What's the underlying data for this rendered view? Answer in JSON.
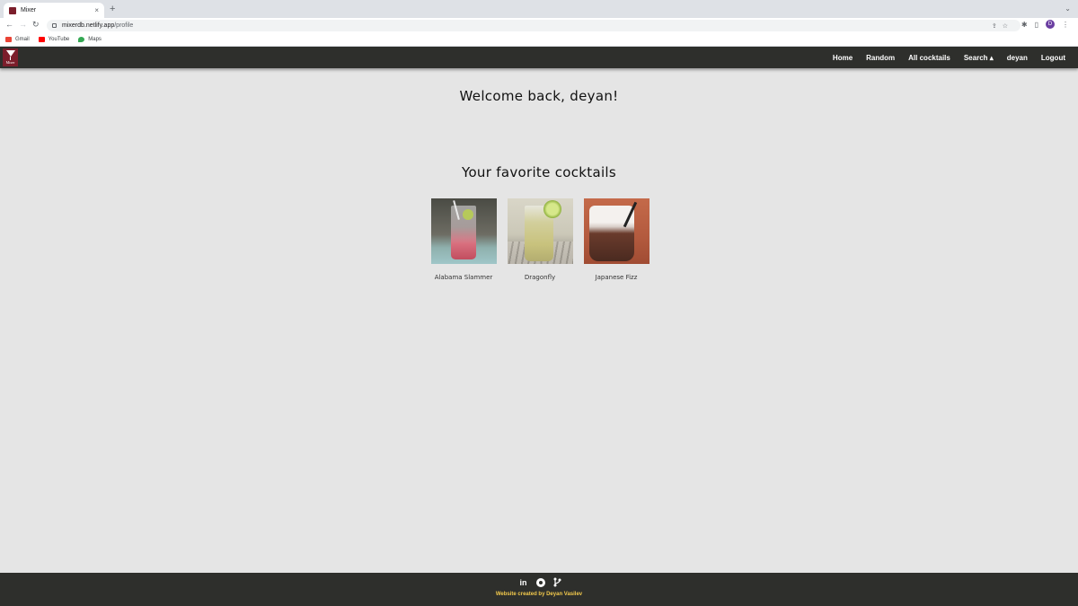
{
  "browser": {
    "tab_title": "Mixer",
    "tab_close": "×",
    "new_tab": "+",
    "url_host": "mixerdb.netlify.app",
    "url_path": "/profile",
    "profile_initial": "D",
    "bookmarks": [
      {
        "label": "Gmail",
        "color": "#ea4335"
      },
      {
        "label": "YouTube",
        "color": "#ff0000"
      },
      {
        "label": "Maps",
        "color": "#34a853"
      }
    ]
  },
  "site": {
    "logo_text": "Mixer",
    "nav": [
      "Home",
      "Random",
      "All cocktails",
      "Search ▴",
      "deyan",
      "Logout"
    ]
  },
  "main": {
    "welcome": "Welcome back, deyan!",
    "favorites_title": "Your favorite cocktails",
    "favorites": [
      {
        "name": "Alabama Slammer"
      },
      {
        "name": "Dragonfly"
      },
      {
        "name": "Japanese Fizz"
      }
    ]
  },
  "footer": {
    "credit": "Website created by Deyan Vasilev",
    "icons": [
      "linkedin-icon",
      "github-icon",
      "git-branch-icon"
    ]
  },
  "colors": {
    "nav_bg": "#2e2f2c",
    "page_bg": "#e5e5e5",
    "credit": "#f2c94c",
    "brand": "#7b1e2b"
  }
}
